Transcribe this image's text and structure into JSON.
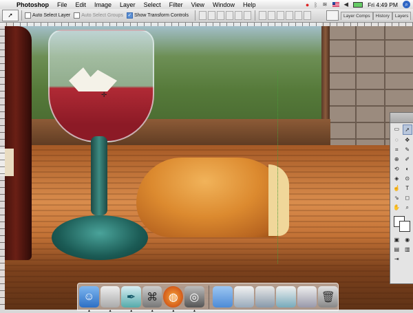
{
  "menubar": {
    "app_name": "Photoshop",
    "menus": [
      "File",
      "Edit",
      "Image",
      "Layer",
      "Select",
      "Filter",
      "View",
      "Window",
      "Help"
    ],
    "clock": "Fri 4:49 PM"
  },
  "options_bar": {
    "auto_select_layer": "Auto Select Layer",
    "auto_select_groups": "Auto Select Groups",
    "show_transform_controls": "Show Transform Controls",
    "well_tabs": [
      "Layer Comps",
      "History",
      "Layers"
    ]
  },
  "toolbox": {
    "tools": [
      "▭",
      "➚",
      "◌",
      "✥",
      "⌗",
      "✎",
      "⊕",
      "✐",
      "⟲",
      "◐",
      "◈",
      "⊙",
      "☝",
      "T",
      "⇘",
      "◻",
      "✋",
      "⌕"
    ]
  },
  "dock": {
    "apps": [
      "Finder",
      "System Preferences",
      "Quill",
      "Preview",
      "Firefox",
      "Image Capture"
    ],
    "docs": [
      "Documents",
      "Window 1",
      "Window 2",
      "Window 3",
      "Window 4",
      "Trash"
    ]
  },
  "colors": {
    "menubar_bg": "#ececec",
    "wine": "#b02a35",
    "guide": "#4b9a3a"
  }
}
